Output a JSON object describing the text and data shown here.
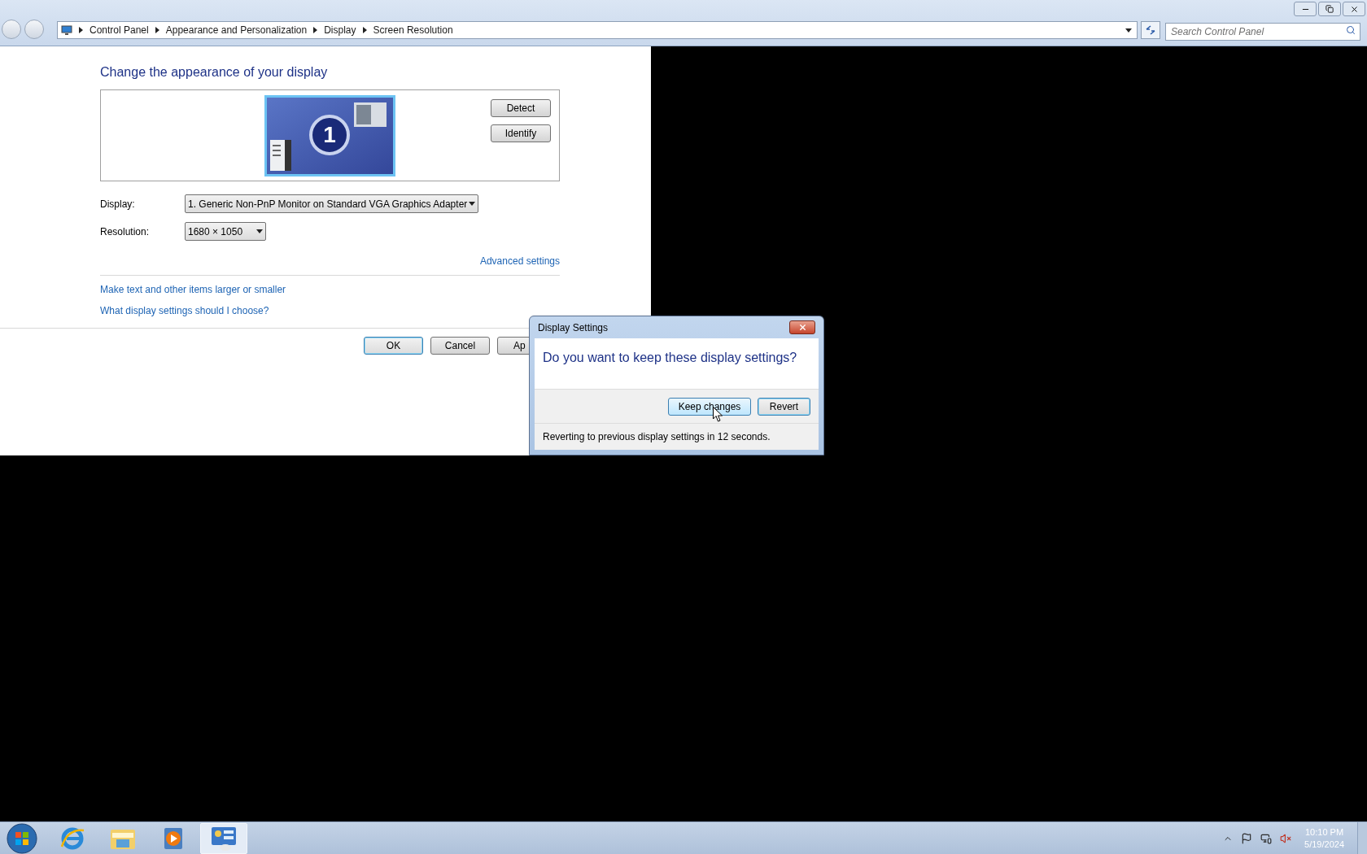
{
  "window": {
    "breadcrumb": [
      {
        "label": "Control Panel"
      },
      {
        "label": "Appearance and Personalization"
      },
      {
        "label": "Display"
      },
      {
        "label": "Screen Resolution"
      }
    ],
    "search": {
      "placeholder": "Search Control Panel"
    }
  },
  "page": {
    "heading": "Change the appearance of your display",
    "monitor": {
      "number": "1",
      "selected": true
    },
    "side_buttons": [
      "Detect",
      "Identify"
    ],
    "fields": [
      {
        "label": "Display:",
        "value": "1. Generic Non-PnP Monitor on Standard VGA Graphics Adapter",
        "kind": "wide"
      },
      {
        "label": "Resolution:",
        "value": "1680 × 1050",
        "kind": "narrow"
      }
    ],
    "advanced_link": "Advanced settings",
    "links": [
      "Make text and other items larger or smaller",
      "What display settings should I choose?"
    ],
    "footer_buttons": [
      {
        "label": "OK",
        "default": true
      },
      {
        "label": "Cancel",
        "default": false
      },
      {
        "label": "Ap",
        "default": false
      }
    ]
  },
  "dialog": {
    "title": "Display Settings",
    "question": "Do you want to keep these display settings?",
    "buttons": [
      {
        "label": "Keep changes",
        "hovered": true,
        "focused": false
      },
      {
        "label": "Revert",
        "hovered": false,
        "focused": true
      }
    ],
    "message": "Reverting to previous display settings in 12 seconds."
  },
  "taskbar": {
    "apps": [
      {
        "kind": "browser",
        "active": false
      },
      {
        "kind": "folder",
        "active": false
      },
      {
        "kind": "media",
        "active": false
      },
      {
        "kind": "control-panel",
        "active": true
      }
    ],
    "clock": {
      "time": "10:10 PM",
      "date": "5/19/2024"
    }
  }
}
